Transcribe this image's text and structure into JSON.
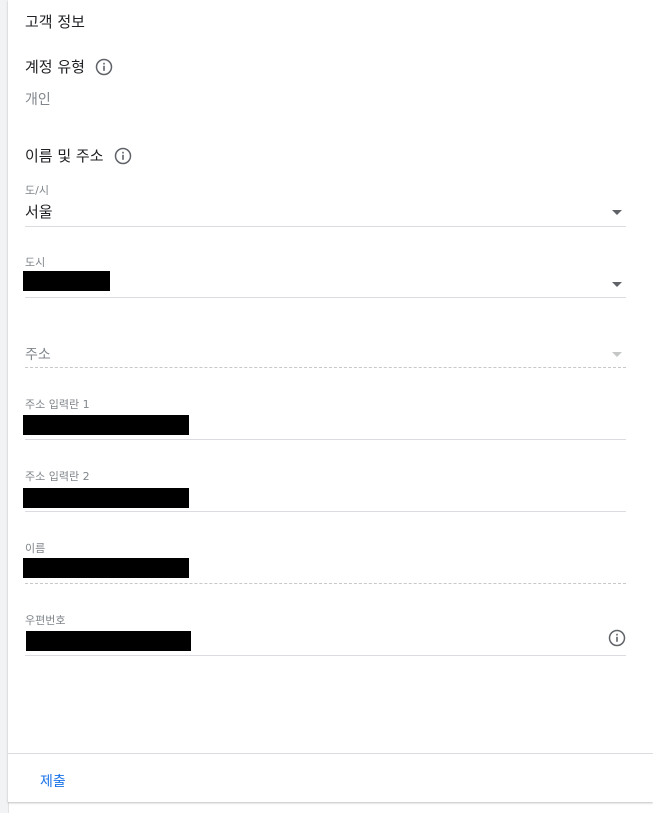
{
  "section": {
    "title": "고객 정보"
  },
  "account_type": {
    "label": "계정 유형",
    "value": "개인"
  },
  "name_address": {
    "label": "이름 및 주소"
  },
  "fields": {
    "province": {
      "label": "도/시",
      "value": "서울"
    },
    "city": {
      "label": "도시"
    },
    "address": {
      "placeholder": "주소"
    },
    "address_line1": {
      "label": "주소 입력란 1"
    },
    "address_line2": {
      "label": "주소 입력란 2"
    },
    "name": {
      "label": "이름"
    },
    "postal_code": {
      "label": "우편번호"
    }
  },
  "footer": {
    "submit_label": "제출"
  },
  "icons": {
    "info": "info-icon",
    "dropdown": "chevron-down-icon"
  },
  "colors": {
    "accent": "#1a73e8",
    "text": "#202124",
    "muted": "#80868b",
    "redaction": "#000000"
  }
}
